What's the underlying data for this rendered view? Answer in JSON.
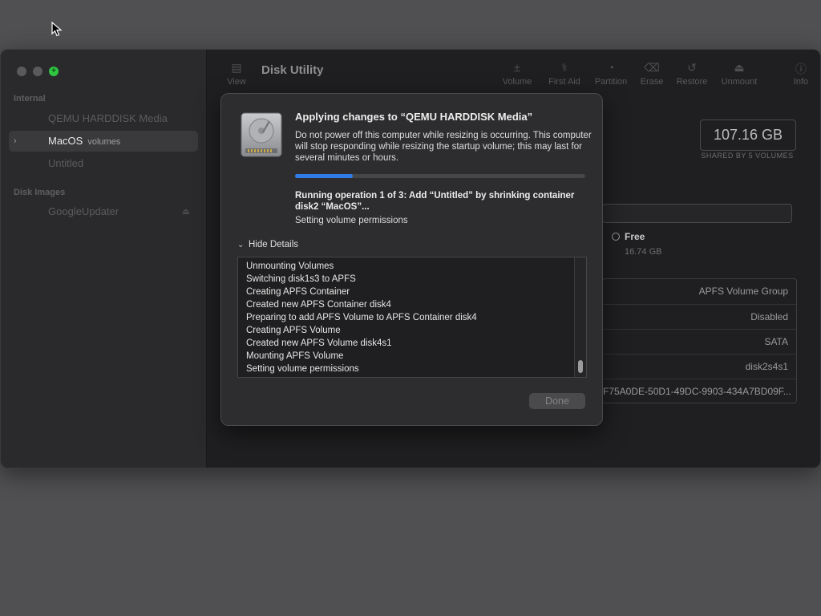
{
  "app": {
    "title": "Disk Utility"
  },
  "sidebar": {
    "sections": [
      {
        "label": "Internal"
      },
      {
        "label": "Disk Images"
      }
    ],
    "items": [
      {
        "label": "QEMU HARDDISK Media",
        "sub": ""
      },
      {
        "label": "MacOS",
        "sub": "volumes"
      },
      {
        "label": "Untitled",
        "sub": ""
      },
      {
        "label": "GoogleUpdater",
        "sub": ""
      }
    ]
  },
  "toolbar": {
    "view_label": "View",
    "buttons": [
      {
        "label": "Volume",
        "icon": "plus-minus-icon"
      },
      {
        "label": "First Aid",
        "icon": "stethoscope-icon"
      },
      {
        "label": "Partition",
        "icon": "pie-icon"
      },
      {
        "label": "Erase",
        "icon": "erase-icon"
      },
      {
        "label": "Restore",
        "icon": "restore-icon"
      },
      {
        "label": "Unmount",
        "icon": "eject-icon"
      },
      {
        "label": "Info",
        "icon": "info-icon"
      }
    ]
  },
  "volume": {
    "capacity": "107.16 GB",
    "capacity_sub": "SHARED BY 5 VOLUMES",
    "free_label": "Free",
    "free_value": "16.74 GB",
    "info": [
      {
        "value": "APFS Volume Group"
      },
      {
        "value": "Disabled"
      },
      {
        "value": "SATA"
      },
      {
        "value": "disk2s4s1"
      },
      {
        "value": "F75A0DE-50D1-49DC-9903-434A7BD09F..."
      }
    ]
  },
  "dialog": {
    "title": "Applying changes to “QEMU HARDDISK Media”",
    "message": "Do not power off this computer while resizing is occurring. This computer will stop responding while resizing the startup volume; this may last for several minutes or hours.",
    "progress": 0.2,
    "operation": "Running operation 1 of 3: Add “Untitled” by shrinking container disk2 “MacOS”...",
    "status": "Setting volume permissions",
    "details_toggle": "Hide Details",
    "log": [
      "Unmounting Volumes",
      "Switching disk1s3 to APFS",
      "Creating APFS Container",
      "Created new APFS Container disk4",
      "Preparing to add APFS Volume to APFS Container disk4",
      "Creating APFS Volume",
      "Created new APFS Volume disk4s1",
      "Mounting APFS Volume",
      "Setting volume permissions"
    ],
    "done_label": "Done"
  },
  "colors": {
    "accent": "#2f7ce8",
    "zoom_button": "#2fc441"
  }
}
